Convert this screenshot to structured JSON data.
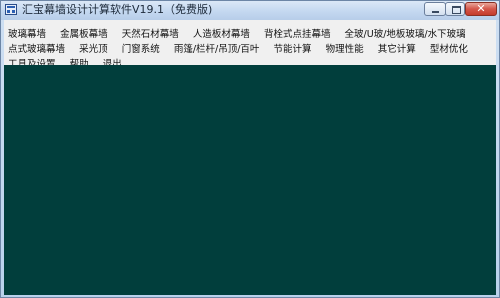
{
  "window": {
    "title": "汇宝幕墙设计计算软件V19.1（免费版)",
    "client_color": "#013e3c"
  },
  "menubar": {
    "rows": [
      [
        "玻璃幕墙",
        "金属板幕墙",
        "天然石材幕墙",
        "人造板材幕墙",
        "背栓式点挂幕墙",
        "全玻/U玻/地板玻璃/水下玻璃"
      ],
      [
        "点式玻璃幕墙",
        "采光顶",
        "门窗系统",
        "雨篷/栏杆/吊顶/百叶",
        "节能计算",
        "物理性能",
        "其它计算",
        "型材优化"
      ],
      [
        "工具及设置",
        "帮助",
        "退出"
      ]
    ]
  },
  "controls": {
    "close_glyph": "✕"
  }
}
